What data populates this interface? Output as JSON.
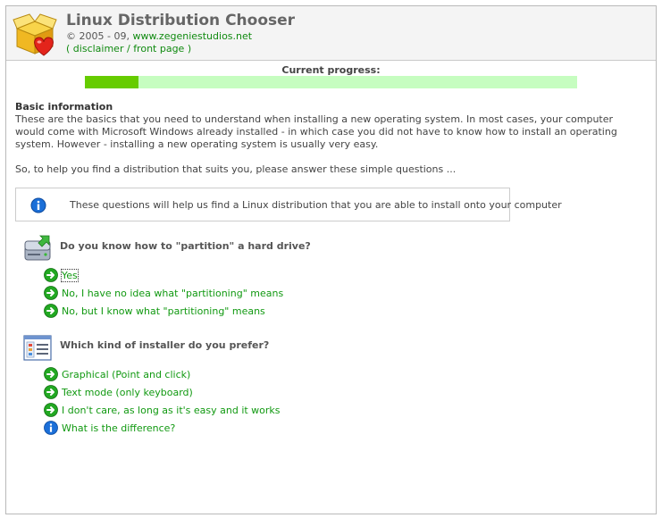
{
  "header": {
    "title": "Linux Distribution Chooser",
    "copyright_prefix": "© 2005 - 09, ",
    "copyright_link": "www.zegeniestudios.net",
    "links_open": "( ",
    "disclaimer": "disclaimer",
    "separator": " / ",
    "front_page": "front page",
    "links_close": " )"
  },
  "progress": {
    "label": "Current progress:",
    "value": 0.109,
    "fill_color": "#66cc00",
    "track_color": "#c6fdc0"
  },
  "intro": {
    "heading": "Basic information",
    "body": "These are the basics that you need to understand when installing a new operating system. In most cases, your computer would come with Microsoft Windows already installed - in which case you did not have to know how to install an operating system. However - installing a new operating system is usually very easy.",
    "question_prompt": "So, to help you find a distribution that suits you, please answer these simple questions ..."
  },
  "info_box": {
    "icon": "info-icon",
    "text": "These questions will help us find a Linux distribution that you are able to install onto your computer"
  },
  "questions": [
    {
      "icon": "hard-drive-icon",
      "text": "Do you know how to \"partition\" a hard drive?",
      "answers": [
        {
          "icon": "green-arrow-icon",
          "label": "Yes",
          "selected": true
        },
        {
          "icon": "green-arrow-icon",
          "label": "No, I have no idea what \"partitioning\" means"
        },
        {
          "icon": "green-arrow-icon",
          "label": "No, but I know what \"partitioning\" means"
        }
      ]
    },
    {
      "icon": "installer-window-icon",
      "text": "Which kind of installer do you prefer?",
      "answers": [
        {
          "icon": "green-arrow-icon",
          "label": "Graphical (Point and click)"
        },
        {
          "icon": "green-arrow-icon",
          "label": "Text mode (only keyboard)"
        },
        {
          "icon": "green-arrow-icon",
          "label": "I don't care, as long as it's easy and it works"
        },
        {
          "icon": "info-icon",
          "label": "What is the difference?"
        }
      ]
    }
  ],
  "colors": {
    "link_green": "#119911",
    "accent_blue": "#1b6fd8"
  }
}
